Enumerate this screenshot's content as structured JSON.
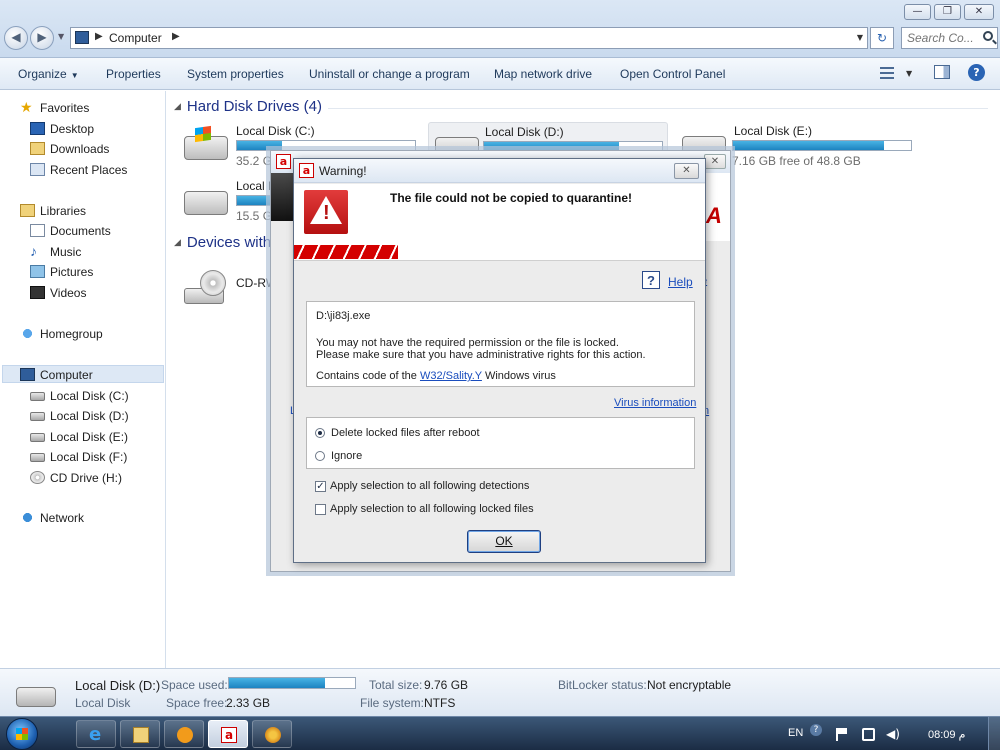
{
  "window": {
    "controls": {
      "minimize": "—",
      "maximize": "❐",
      "close": "✕"
    }
  },
  "address": {
    "crumb": "Computer",
    "search_placeholder": "Search Co..."
  },
  "toolbar": {
    "organize": "Organize",
    "properties": "Properties",
    "system_properties": "System properties",
    "uninstall": "Uninstall or change a program",
    "map_drive": "Map network drive",
    "control_panel": "Open Control Panel"
  },
  "sidebar": {
    "favorites": "Favorites",
    "desktop": "Desktop",
    "downloads": "Downloads",
    "recent": "Recent Places",
    "libraries": "Libraries",
    "documents": "Documents",
    "music": "Music",
    "pictures": "Pictures",
    "videos": "Videos",
    "homegroup": "Homegroup",
    "computer": "Computer",
    "disk_c": "Local Disk (C:)",
    "disk_d": "Local Disk (D:)",
    "disk_e": "Local Disk (E:)",
    "disk_f": "Local Disk (F:)",
    "cd_drive": "CD Drive (H:)",
    "network": "Network"
  },
  "content": {
    "hdd_header": "Hard Disk Drives (4)",
    "devices_header": "Devices with",
    "drive_c": {
      "name": "Local Disk (C:)",
      "free": "35.2 GB",
      "used_fraction": 0.25
    },
    "drive_d": {
      "name": "Local Disk (D:)",
      "used_fraction": 0.76
    },
    "drive_e": {
      "name": "Local Disk (E:)",
      "free": "7.16 GB free of 48.8 GB",
      "used_fraction": 0.85
    },
    "drive_f": {
      "name": "Local D",
      "free": "15.5 G",
      "used_fraction": 0.25
    },
    "cd_drive": {
      "name": "CD-RW"
    }
  },
  "details": {
    "drive_name": "Local Disk (D:)",
    "drive_type": "Local Disk",
    "space_used_label": "Space used:",
    "space_used_fraction": 0.76,
    "space_free_label": "Space free:",
    "space_free": "2.33 GB",
    "total_size_label": "Total size:",
    "total_size": "9.76 GB",
    "file_system_label": "File system:",
    "file_system": "NTFS",
    "bitlocker_label": "BitLocker status:",
    "bitlocker": "Not encryptable"
  },
  "background_dialog": {
    "help_fragment": "e",
    "link_fragment": "n",
    "left_fragment": "L"
  },
  "dialog": {
    "title": "Warning!",
    "heading": "The file could not be copied to quarantine!",
    "help": "Help",
    "filename": "D:\\ji83j.exe",
    "message_line1": "You may not have the required permission or the file is locked.",
    "message_line2": "Please make sure that you have administrative rights for this action.",
    "contains_prefix": "Contains code of the ",
    "virus_name": "W32/Sality.Y",
    "contains_suffix": " Windows virus",
    "virus_info": "Virus information",
    "option_delete": "Delete locked files after reboot",
    "option_ignore": "Ignore",
    "selected_option": "delete",
    "apply_detections": "Apply selection to all following detections",
    "apply_detections_checked": true,
    "apply_locked": "Apply selection to all following locked files",
    "apply_locked_checked": false,
    "ok": "OK"
  },
  "taskbar": {
    "language": "EN",
    "time": "08:09 م"
  },
  "colors": {
    "avira_red": "#d40000",
    "link_blue": "#1a4dbd",
    "bar_blue": "#1d83c0",
    "heading_blue": "#1e3287"
  }
}
